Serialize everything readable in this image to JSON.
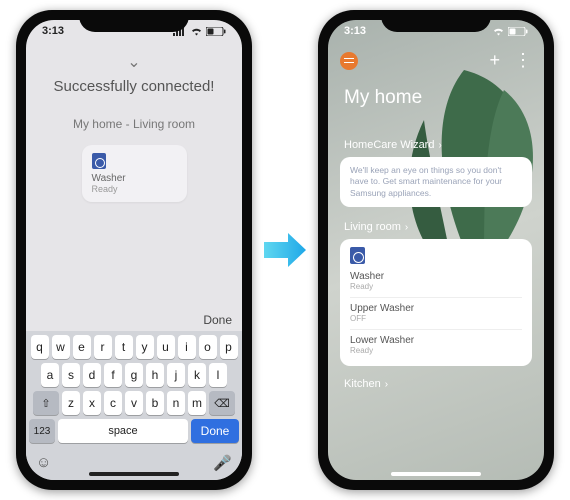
{
  "status": {
    "time": "3:13"
  },
  "left": {
    "title": "Successfully connected!",
    "location": "My home - Living room",
    "card": {
      "name": "Washer",
      "status": "Ready"
    },
    "keyboard": {
      "done_top": "Done",
      "rows": [
        [
          "q",
          "w",
          "e",
          "r",
          "t",
          "y",
          "u",
          "i",
          "o",
          "p"
        ],
        [
          "a",
          "s",
          "d",
          "f",
          "g",
          "h",
          "j",
          "k",
          "l"
        ],
        [
          "z",
          "x",
          "c",
          "v",
          "b",
          "n",
          "m"
        ]
      ],
      "num_key": "123",
      "space": "space",
      "done": "Done"
    }
  },
  "right": {
    "title": "My home",
    "sections": {
      "wizard": "HomeCare Wizard",
      "living": "Living room",
      "kitchen": "Kitchen"
    },
    "wizard_text": "We'll keep an eye on things so you don't have to. Get smart maintenance for your Samsung appliances.",
    "devices": [
      {
        "name": "Washer",
        "status": "Ready"
      },
      {
        "name": "Upper Washer",
        "status": "OFF"
      },
      {
        "name": "Lower Washer",
        "status": "Ready"
      }
    ]
  }
}
